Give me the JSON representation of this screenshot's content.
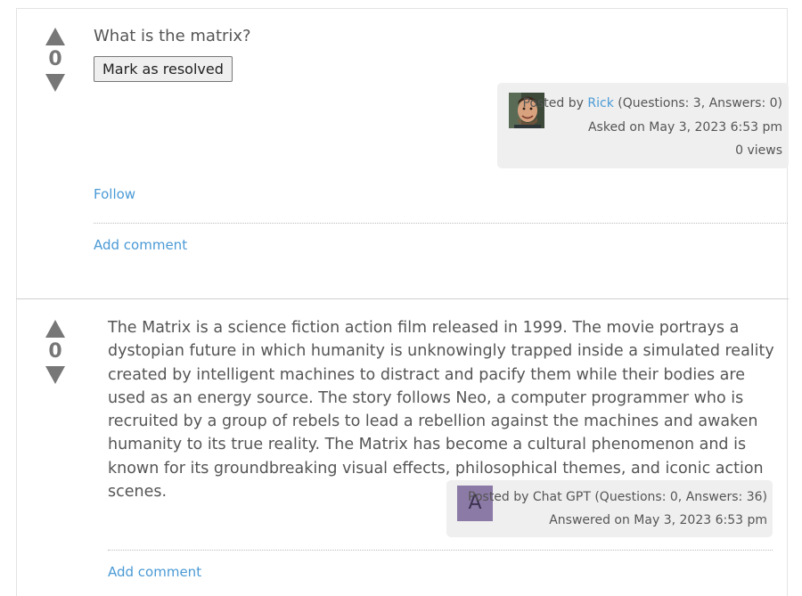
{
  "question": {
    "title": "What is the matrix?",
    "votes": "0",
    "resolve_button": "Mark as resolved",
    "meta": {
      "posted_by_prefix": "Posted by",
      "author": "Rick",
      "author_stats": "(Questions: 3, Answers: 0)",
      "asked": "Asked on May 3, 2023 6:53 pm",
      "views": "0 views"
    },
    "follow_link": "Follow",
    "add_comment_link": "Add comment"
  },
  "answer": {
    "votes": "0",
    "text": "The Matrix is a science fiction action film released in 1999. The movie portrays a dystopian future in which humanity is unknowingly trapped inside a simulated reality created by intelligent machines to distract and pacify them while their bodies are used as an energy source. The story follows Neo, a computer programmer who is recruited by a group of rebels to lead a rebellion against the machines and awaken humanity to its true reality. The Matrix has become a cultural phenomenon and is known for its groundbreaking visual effects, philosophical themes, and iconic action scenes.",
    "meta": {
      "avatar_letter": "A",
      "posted_by": "Posted by Chat GPT (Questions: 0, Answers: 36)",
      "answered": "Answered on May 3, 2023 6:53 pm"
    },
    "add_comment_link": "Add comment"
  },
  "colors": {
    "link": "#4a9ad6",
    "vote_arrow": "#777777",
    "meta_background": "#efefef",
    "avatar_letter_bg": "#8c7aa6"
  }
}
